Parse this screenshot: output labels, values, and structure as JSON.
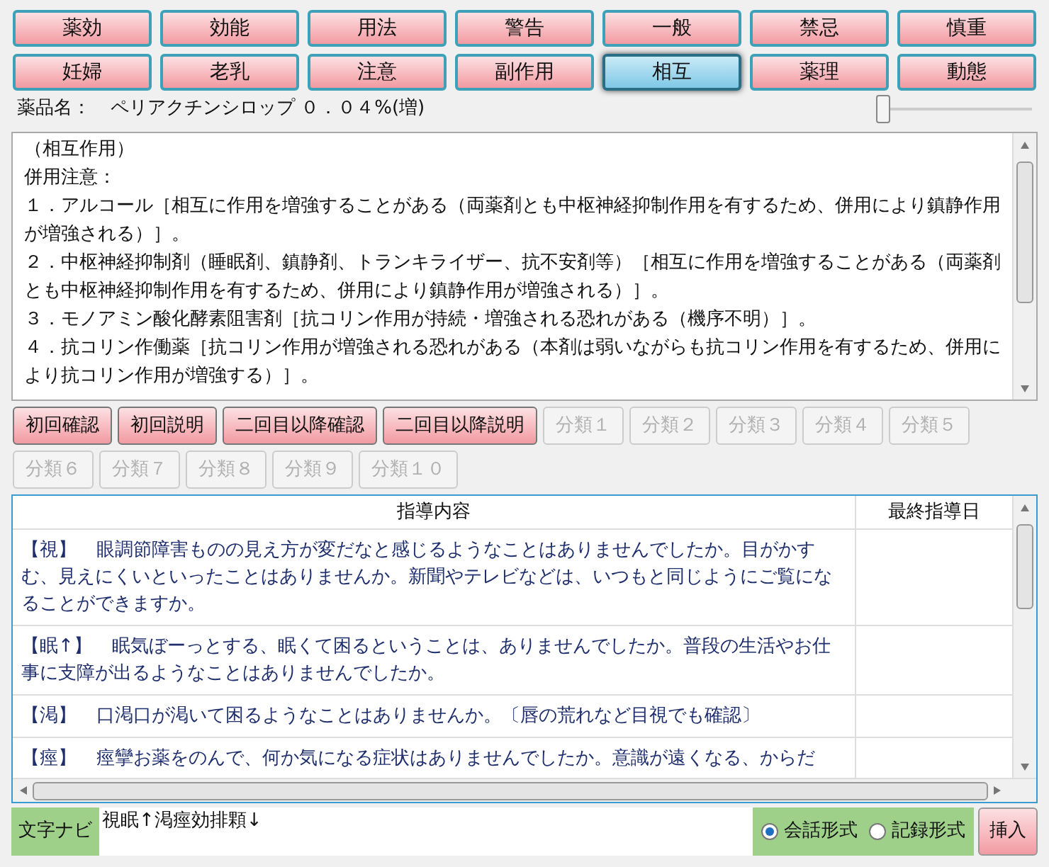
{
  "section_tabs": [
    {
      "label": "薬効",
      "selected": false
    },
    {
      "label": "効能",
      "selected": false
    },
    {
      "label": "用法",
      "selected": false
    },
    {
      "label": "警告",
      "selected": false
    },
    {
      "label": "一般",
      "selected": false
    },
    {
      "label": "禁忌",
      "selected": false
    },
    {
      "label": "慎重",
      "selected": false
    },
    {
      "label": "妊婦",
      "selected": false
    },
    {
      "label": "老乳",
      "selected": false
    },
    {
      "label": "注意",
      "selected": false
    },
    {
      "label": "副作用",
      "selected": false
    },
    {
      "label": "相互",
      "selected": true
    },
    {
      "label": "薬理",
      "selected": false
    },
    {
      "label": "動態",
      "selected": false
    }
  ],
  "drug": {
    "label": "薬品名：",
    "name": "ペリアクチンシロップ ０．０４%(増)",
    "zoom_slider": {
      "level": 0
    }
  },
  "document": [
    "（相互作用）",
    "併用注意：",
    "１．アルコール［相互に作用を増強することがある（両薬剤とも中枢神経抑制作用を有するため、併用により鎮静作用が増強される）］。",
    "２．中枢神経抑制剤（睡眠剤、鎮静剤、トランキライザー、抗不安剤等）［相互に作用を増強することがある（両薬剤とも中枢神経抑制作用を有するため、併用により鎮静作用が増強される）］。",
    "３．モノアミン酸化酵素阻害剤［抗コリン作用が持続・増強される恐れがある（機序不明）］。",
    "４．抗コリン作働薬［抗コリン作用が増強される恐れがある（本剤は弱いながらも抗コリン作用を有するため、併用により抗コリン作用が増強する）］。"
  ],
  "category_buttons": [
    {
      "label": "初回確認",
      "disabled": false
    },
    {
      "label": "初回説明",
      "disabled": false
    },
    {
      "label": "二回目以降確認",
      "disabled": false
    },
    {
      "label": "二回目以降説明",
      "disabled": false
    },
    {
      "label": "分類１",
      "disabled": true
    },
    {
      "label": "分類２",
      "disabled": true
    },
    {
      "label": "分類３",
      "disabled": true
    },
    {
      "label": "分類４",
      "disabled": true
    },
    {
      "label": "分類５",
      "disabled": true
    },
    {
      "label": "分類６",
      "disabled": true
    },
    {
      "label": "分類７",
      "disabled": true
    },
    {
      "label": "分類８",
      "disabled": true
    },
    {
      "label": "分類９",
      "disabled": true
    },
    {
      "label": "分類１０",
      "disabled": true
    }
  ],
  "table": {
    "columns": [
      "指導内容",
      "最終指導日"
    ],
    "rows": [
      {
        "tag": "【視】",
        "text": "眼調節障害ものの見え方が変だなと感じるようなことはありませんでしたか。目がかすむ、見えにくいといったことはありませんか。新聞やテレビなどは、いつもと同じようにご覧になることができますか。"
      },
      {
        "tag": "【眠↑】",
        "text": "眠気ぼーっとする、眠くて困るということは、ありませんでしたか。普段の生活やお仕事に支障が出るようなことはありませんでしたか。"
      },
      {
        "tag": "【渇】",
        "text": "口渇口が渇いて困るようなことはありませんか。〔唇の荒れなど目視でも確認〕"
      },
      {
        "tag": "【痙】",
        "text": "痙攣お薬をのんで、何か気になる症状はありませんでしたか。意識が遠くなる、からだ"
      }
    ]
  },
  "footer": {
    "nav_label": "文字ナビ",
    "nav_value": "視眠↑渇痙効排顆↓",
    "formats": [
      {
        "label": "会話形式",
        "selected": true
      },
      {
        "label": "記録形式",
        "selected": false
      }
    ],
    "insert_button": "挿入"
  }
}
